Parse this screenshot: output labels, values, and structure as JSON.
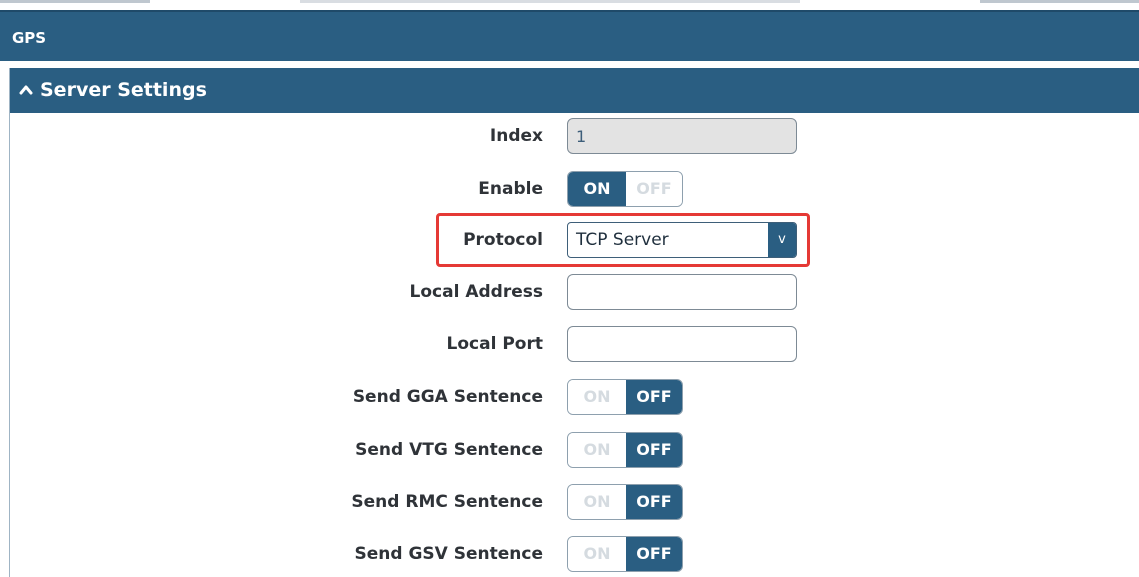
{
  "header": {
    "title": "GPS"
  },
  "panel": {
    "title": "Server Settings",
    "expanded": true,
    "collapse_icon": "chevron-up-icon"
  },
  "form": {
    "index": {
      "label": "Index",
      "value": "1"
    },
    "enable": {
      "label": "Enable",
      "on_label": "ON",
      "off_label": "OFF",
      "state": "on"
    },
    "protocol": {
      "label": "Protocol",
      "value": "TCP Server",
      "arrow": "v"
    },
    "local_address": {
      "label": "Local Address",
      "value": ""
    },
    "local_port": {
      "label": "Local Port",
      "value": ""
    },
    "send_gga": {
      "label": "Send GGA Sentence",
      "on_label": "ON",
      "off_label": "OFF",
      "state": "off"
    },
    "send_vtg": {
      "label": "Send VTG Sentence",
      "on_label": "ON",
      "off_label": "OFF",
      "state": "off"
    },
    "send_rmc": {
      "label": "Send RMC Sentence",
      "on_label": "ON",
      "off_label": "OFF",
      "state": "off"
    },
    "send_gsv": {
      "label": "Send GSV Sentence",
      "on_label": "ON",
      "off_label": "OFF",
      "state": "off"
    }
  },
  "colors": {
    "header_bg": "#2a5e82",
    "toggle_active": "#2a5e82",
    "highlight": "#e53935"
  }
}
